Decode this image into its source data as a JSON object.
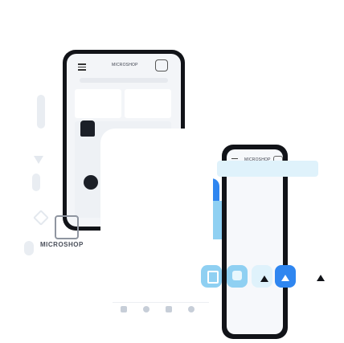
{
  "logo": {
    "text": "MICROSHOP"
  },
  "phone_back": {
    "header_brand": "MICROSHOP"
  },
  "phone_front": {
    "header_brand": "MICROSHOP"
  },
  "colors": {
    "accent_blue": "#2f86f0",
    "light_blue": "#8fd0f2",
    "pale_cyan": "#dff2fb",
    "phone_frame": "#111318",
    "screen": "#f3f5f8"
  },
  "icons": [
    "menu-icon",
    "chat-icon",
    "tshirt-icon",
    "bag-icon",
    "dress-icon",
    "home-icon",
    "cart-icon",
    "user-icon",
    "play-icon",
    "pen-icon"
  ]
}
